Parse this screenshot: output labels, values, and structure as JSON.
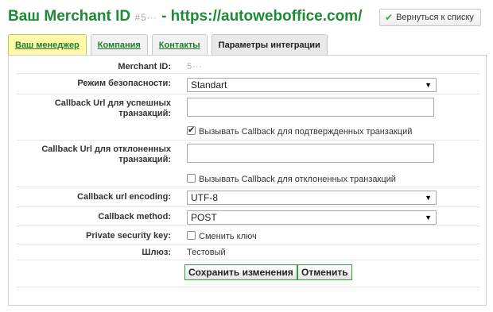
{
  "header": {
    "title_prefix": "Ваш Merchant ID",
    "merchant_id_masked": "#5∙∙∙",
    "title_suffix": "- https://autoweboffice.com/",
    "back_button_label": "Вернуться к списку"
  },
  "tabs": [
    {
      "label": "Ваш менеджер"
    },
    {
      "label": "Компания"
    },
    {
      "label": "Контакты"
    },
    {
      "label": "Параметры интеграции"
    }
  ],
  "form": {
    "merchant_id_label": "Merchant ID:",
    "merchant_id_value": "5∙∙∙",
    "security_mode_label": "Режим безопасности:",
    "security_mode_value": "Standart",
    "success_url_label": "Callback Url для успешных транзакций:",
    "success_url_value": "",
    "success_callback_checkbox_label": "Вызывать Callback для подтвержденных транзакций",
    "success_callback_checked": true,
    "declined_url_label": "Callback Url для отклоненных транзакций:",
    "declined_url_value": "",
    "declined_callback_checkbox_label": "Вызывать Callback для отклоненных транзакций",
    "declined_callback_checked": false,
    "encoding_label": "Callback url encoding:",
    "encoding_value": "UTF-8",
    "method_label": "Callback method:",
    "method_value": "POST",
    "private_key_label": "Private security key:",
    "private_key_checkbox_label": "Сменить ключ",
    "private_key_checked": false,
    "gateway_label": "Шлюз:",
    "gateway_value": "Тестовый",
    "save_button_label": "Сохранить изменения",
    "cancel_button_label": "Отменить"
  },
  "colors": {
    "brand_green": "#1c8a34",
    "active_tab_yellow": "#fff9a8"
  }
}
